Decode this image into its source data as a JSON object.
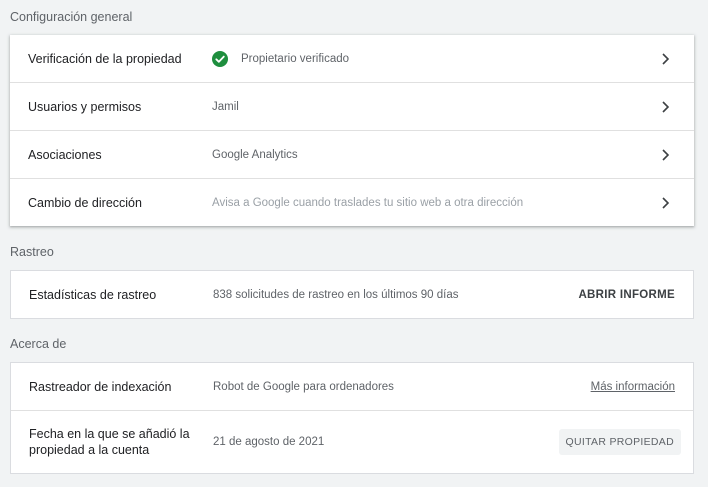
{
  "general": {
    "title": "Configuración general",
    "rows": [
      {
        "label": "Verificación de la propiedad",
        "value": "Propietario verificado"
      },
      {
        "label": "Usuarios y permisos",
        "value": "Jamil"
      },
      {
        "label": "Asociaciones",
        "value": "Google Analytics"
      },
      {
        "label": "Cambio de dirección",
        "value": "Avisa a Google cuando traslades tu sitio web a otra dirección"
      }
    ]
  },
  "crawl": {
    "title": "Rastreo",
    "rows": [
      {
        "label": "Estadísticas de rastreo",
        "value": "838 solicitudes de rastreo en los últimos 90 días",
        "action": "ABRIR INFORME"
      }
    ]
  },
  "about": {
    "title": "Acerca de",
    "rows": [
      {
        "label": "Rastreador de indexación",
        "value": "Robot de Google para ordenadores",
        "action": "Más información"
      },
      {
        "label": "Fecha en la que se añadió la propiedad a la cuenta",
        "value": "21 de agosto de 2021",
        "action": "QUITAR PROPIEDAD"
      }
    ]
  },
  "colors": {
    "verified": "#1e8e3e",
    "background": "#f1f3f4",
    "card": "#ffffff"
  },
  "icons": {
    "verified": "check-circle-icon",
    "row_arrow": "chevron-right-icon"
  }
}
